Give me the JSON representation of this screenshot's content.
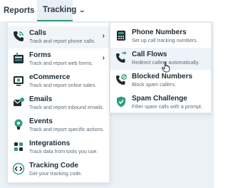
{
  "nav": {
    "reports": "Reports",
    "tracking": "Tracking"
  },
  "menu": {
    "items": [
      {
        "title": "Calls",
        "desc": "Track and report phone calls.",
        "icon": "phone-icon",
        "has_submenu": true
      },
      {
        "title": "Forms",
        "desc": "Track and report web forms.",
        "icon": "form-icon",
        "has_submenu": true
      },
      {
        "title": "eCommerce",
        "desc": "Track and report online sales.",
        "icon": "ecommerce-icon",
        "has_submenu": false
      },
      {
        "title": "Emails",
        "desc": "Track and report inbound emails.",
        "icon": "email-icon",
        "has_submenu": false
      },
      {
        "title": "Events",
        "desc": "Track and report specific actions.",
        "icon": "event-icon",
        "has_submenu": false
      },
      {
        "title": "Integrations",
        "desc": "Track data from tools you use.",
        "icon": "integrations-icon",
        "has_submenu": false
      },
      {
        "title": "Tracking Code",
        "desc": "Get your tracking code.",
        "icon": "code-icon",
        "has_submenu": false
      }
    ]
  },
  "submenu": {
    "items": [
      {
        "title": "Phone Numbers",
        "desc": "Set up call tracking numbers.",
        "icon": "phone-numbers-icon"
      },
      {
        "title": "Call Flows",
        "desc": "Redirect callers automatically.",
        "icon": "call-flows-icon"
      },
      {
        "title": "Blocked Numbers",
        "desc": "Block spam callers.",
        "icon": "blocked-icon"
      },
      {
        "title": "Spam Challenge",
        "desc": "Filter spam calls with a prompt.",
        "icon": "shield-icon"
      }
    ]
  },
  "colors": {
    "accent": "#2f9e82",
    "text": "#1f2b33",
    "muted": "#5d6b75"
  }
}
